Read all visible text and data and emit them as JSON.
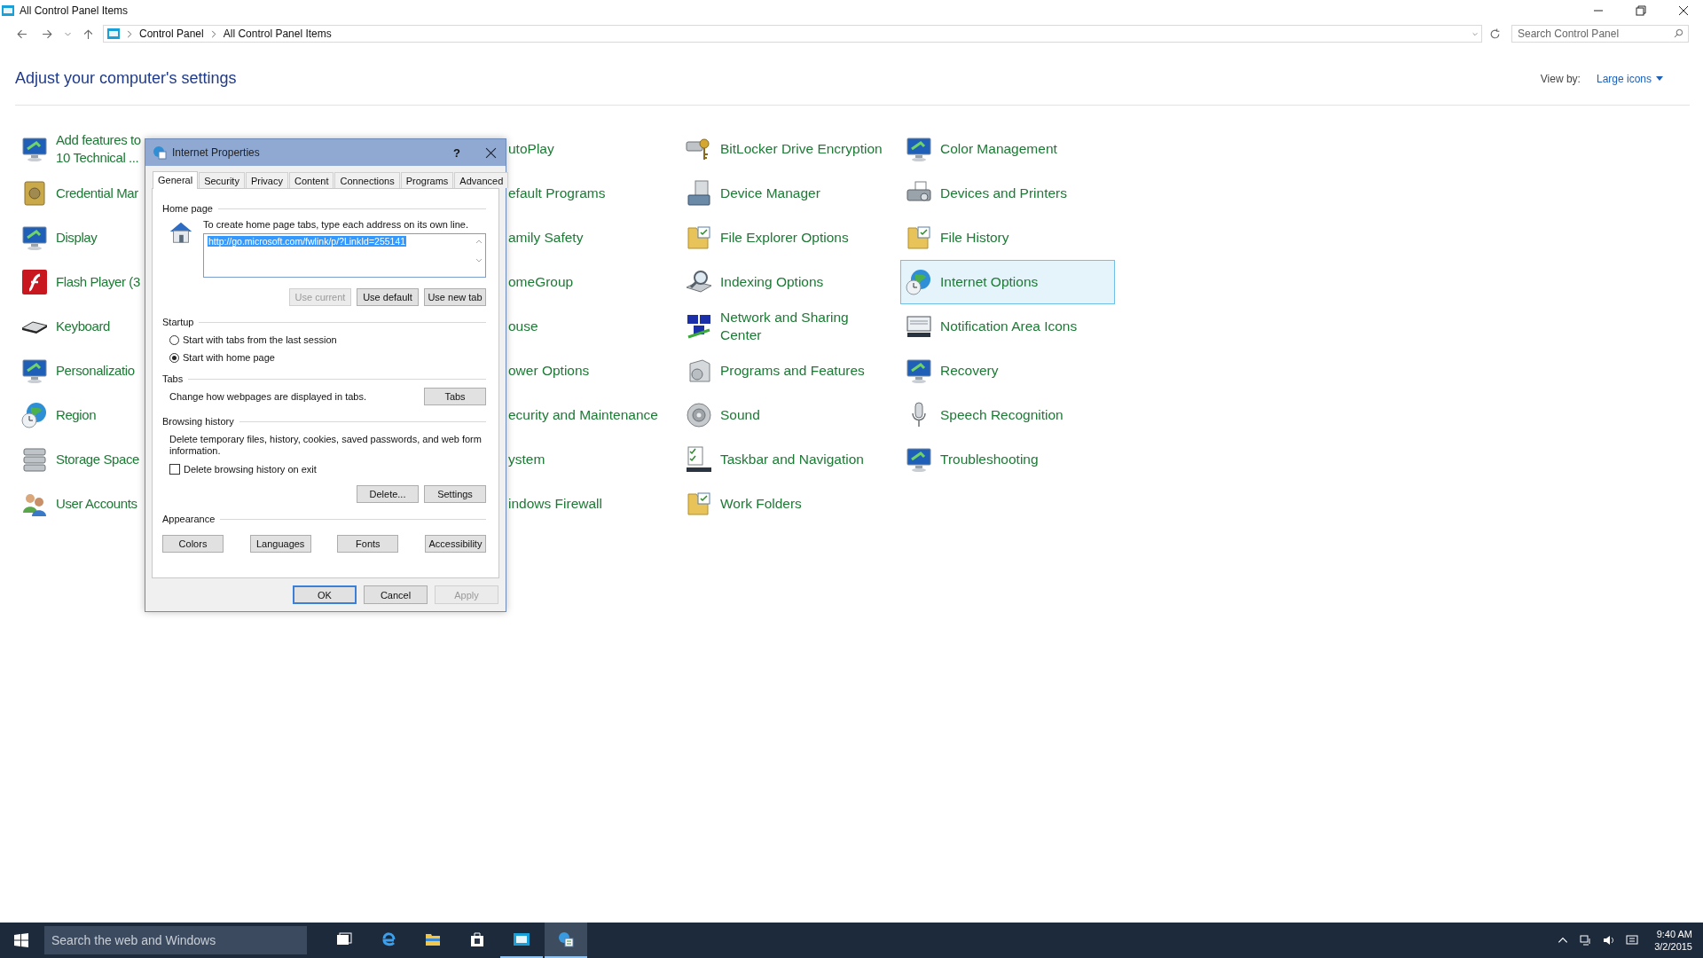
{
  "window": {
    "title": "All Control Panel Items"
  },
  "address_bar": {
    "breadcrumbs": [
      "Control Panel",
      "All Control Panel Items"
    ]
  },
  "search": {
    "placeholder": "Search Control Panel"
  },
  "heading": "Adjust your computer's settings",
  "view_by": {
    "label": "View by:",
    "value": "Large icons"
  },
  "columns": [
    {
      "items": [
        {
          "label": "Add features to\n10 Technical ...",
          "selected": false
        },
        {
          "label": "Credential Mar",
          "selected": false
        },
        {
          "label": "Display",
          "selected": false
        },
        {
          "label": "Flash Player (3",
          "selected": false
        },
        {
          "label": "Keyboard",
          "selected": false
        },
        {
          "label": "Personalizatio",
          "selected": false
        },
        {
          "label": "Region",
          "selected": false
        },
        {
          "label": "Storage Space",
          "selected": false
        },
        {
          "label": "User Accounts",
          "selected": false
        }
      ]
    },
    {
      "items": [
        {
          "label": "utoPlay",
          "selected": false
        },
        {
          "label": "efault Programs",
          "selected": false
        },
        {
          "label": "amily Safety",
          "selected": false
        },
        {
          "label": "omeGroup",
          "selected": false
        },
        {
          "label": "ouse",
          "selected": false
        },
        {
          "label": "ower Options",
          "selected": false
        },
        {
          "label": "ecurity and Maintenance",
          "selected": false
        },
        {
          "label": "ystem",
          "selected": false
        },
        {
          "label": "indows Firewall",
          "selected": false
        }
      ]
    },
    {
      "items": [
        {
          "label": "BitLocker Drive Encryption",
          "selected": false
        },
        {
          "label": "Device Manager",
          "selected": false
        },
        {
          "label": "File Explorer Options",
          "selected": false
        },
        {
          "label": "Indexing Options",
          "selected": false
        },
        {
          "label": "Network and Sharing\nCenter",
          "selected": false
        },
        {
          "label": "Programs and Features",
          "selected": false
        },
        {
          "label": "Sound",
          "selected": false
        },
        {
          "label": "Taskbar and Navigation",
          "selected": false
        },
        {
          "label": "Work Folders",
          "selected": false
        }
      ]
    },
    {
      "items": [
        {
          "label": "Color Management",
          "selected": false
        },
        {
          "label": "Devices and Printers",
          "selected": false
        },
        {
          "label": "File History",
          "selected": false
        },
        {
          "label": "Internet Options",
          "selected": true
        },
        {
          "label": "Notification Area Icons",
          "selected": false
        },
        {
          "label": "Recovery",
          "selected": false
        },
        {
          "label": "Speech Recognition",
          "selected": false
        },
        {
          "label": "Troubleshooting",
          "selected": false
        }
      ]
    }
  ],
  "dialog": {
    "title": "Internet Properties",
    "help": "?",
    "tabs": [
      {
        "label": "General",
        "selected": true
      },
      {
        "label": "Security",
        "selected": false
      },
      {
        "label": "Privacy",
        "selected": false
      },
      {
        "label": "Content",
        "selected": false
      },
      {
        "label": "Connections",
        "selected": false
      },
      {
        "label": "Programs",
        "selected": false
      },
      {
        "label": "Advanced",
        "selected": false
      }
    ],
    "home_page": {
      "heading": "Home page",
      "hint": "To create home page tabs, type each address on its own line.",
      "value": "http://go.microsoft.com/fwlink/p/?LinkId=255141",
      "highlighted": true,
      "buttons": [
        {
          "label": "Use current",
          "disabled": true
        },
        {
          "label": "Use default",
          "disabled": false
        },
        {
          "label": "Use new tab",
          "disabled": false
        }
      ]
    },
    "startup": {
      "heading": "Startup",
      "options": [
        {
          "label": "Start with tabs from the last session",
          "selected": false
        },
        {
          "label": "Start with home page",
          "selected": true
        }
      ]
    },
    "tabs_section": {
      "heading": "Tabs",
      "text": "Change how webpages are displayed in tabs.",
      "button": "Tabs"
    },
    "browsing_history": {
      "heading": "Browsing history",
      "text": "Delete temporary files, history, cookies, saved passwords, and web form information.",
      "checkbox": {
        "label": "Delete browsing history on exit",
        "checked": false
      },
      "buttons": [
        "Delete...",
        "Settings"
      ]
    },
    "appearance": {
      "heading": "Appearance",
      "buttons": [
        "Colors",
        "Languages",
        "Fonts",
        "Accessibility"
      ]
    },
    "footer_buttons": [
      {
        "label": "OK",
        "default": true,
        "disabled": false
      },
      {
        "label": "Cancel",
        "default": false,
        "disabled": false
      },
      {
        "label": "Apply",
        "default": false,
        "disabled": true
      }
    ]
  },
  "taskbar": {
    "search_placeholder": "Search the web and Windows",
    "apps": [
      {
        "open": false,
        "selected": false
      },
      {
        "open": false,
        "selected": false
      },
      {
        "open": false,
        "selected": false
      },
      {
        "open": false,
        "selected": false
      },
      {
        "open": true,
        "selected": false
      },
      {
        "open": true,
        "selected": true
      }
    ],
    "time": "9:40 AM",
    "date": "3/2/2015"
  }
}
